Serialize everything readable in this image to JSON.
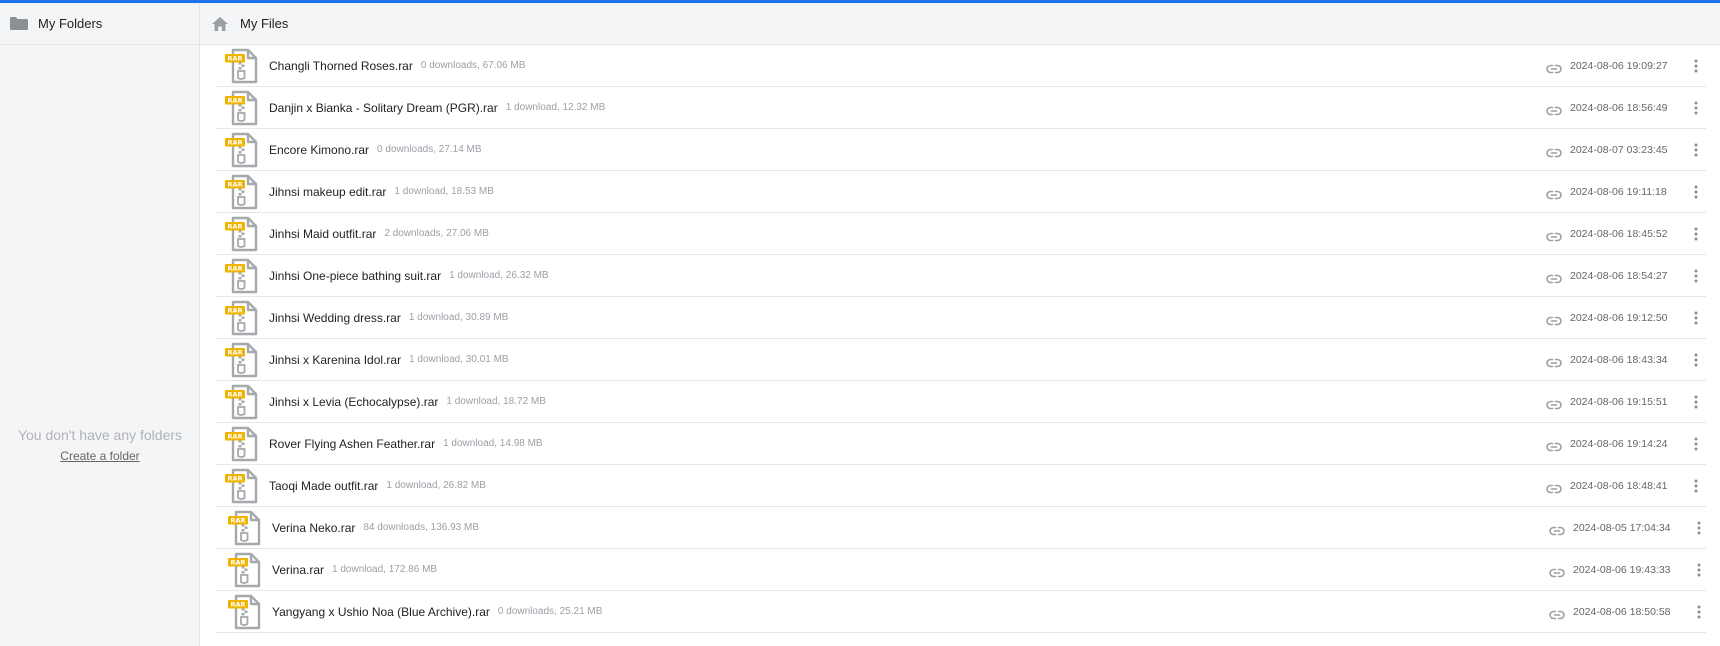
{
  "sidebar": {
    "title": "My Folders",
    "empty_text": "You don't have any folders",
    "create_link": "Create a folder"
  },
  "breadcrumb": {
    "title": "My Files"
  },
  "colors": {
    "accent": "#1a73e8",
    "rar_badge": "#f0b400"
  },
  "icons": {
    "folder": "folder-icon",
    "home": "home-icon",
    "file": "rar-file-icon",
    "link": "link-icon",
    "more": "more-vertical-icon"
  },
  "files": [
    {
      "name": "Changli Thorned Roses.rar",
      "meta": "0 downloads, 67.06 MB",
      "date": "2024-08-06 19:09:27"
    },
    {
      "name": "Danjin x Bianka - Solitary Dream (PGR).rar",
      "meta": "1 download, 12.32 MB",
      "date": "2024-08-06 18:56:49"
    },
    {
      "name": "Encore Kimono.rar",
      "meta": "0 downloads, 27.14 MB",
      "date": "2024-08-07 03:23:45"
    },
    {
      "name": "Jihnsi makeup edit.rar",
      "meta": "1 download, 18.53 MB",
      "date": "2024-08-06 19:11:18"
    },
    {
      "name": "Jinhsi Maid outfit.rar",
      "meta": "2 downloads, 27.06 MB",
      "date": "2024-08-06 18:45:52"
    },
    {
      "name": "Jinhsi One-piece bathing suit.rar",
      "meta": "1 download, 26.32 MB",
      "date": "2024-08-06 18:54:27"
    },
    {
      "name": "Jinhsi Wedding dress.rar",
      "meta": "1 download, 30.89 MB",
      "date": "2024-08-06 19:12:50"
    },
    {
      "name": "Jinhsi x Karenina Idol.rar",
      "meta": "1 download, 30.01 MB",
      "date": "2024-08-06 18:43:34"
    },
    {
      "name": "Jinhsi x Levia (Echocalypse).rar",
      "meta": "1 download, 18.72 MB",
      "date": "2024-08-06 19:15:51"
    },
    {
      "name": "Rover Flying Ashen Feather.rar",
      "meta": "1 download, 14.98 MB",
      "date": "2024-08-06 19:14:24"
    },
    {
      "name": "Taoqi Made outfit.rar",
      "meta": "1 download, 26.82 MB",
      "date": "2024-08-06 18:48:41"
    },
    {
      "name": "Verina Neko.rar",
      "meta": "84 downloads, 136.93 MB",
      "date": "2024-08-05 17:04:34"
    },
    {
      "name": "Verina.rar",
      "meta": "1 download, 172.86 MB",
      "date": "2024-08-06 19:43:33"
    },
    {
      "name": "Yangyang x Ushio Noa (Blue Archive).rar",
      "meta": "0 downloads, 25.21 MB",
      "date": "2024-08-06 18:50:58"
    }
  ]
}
